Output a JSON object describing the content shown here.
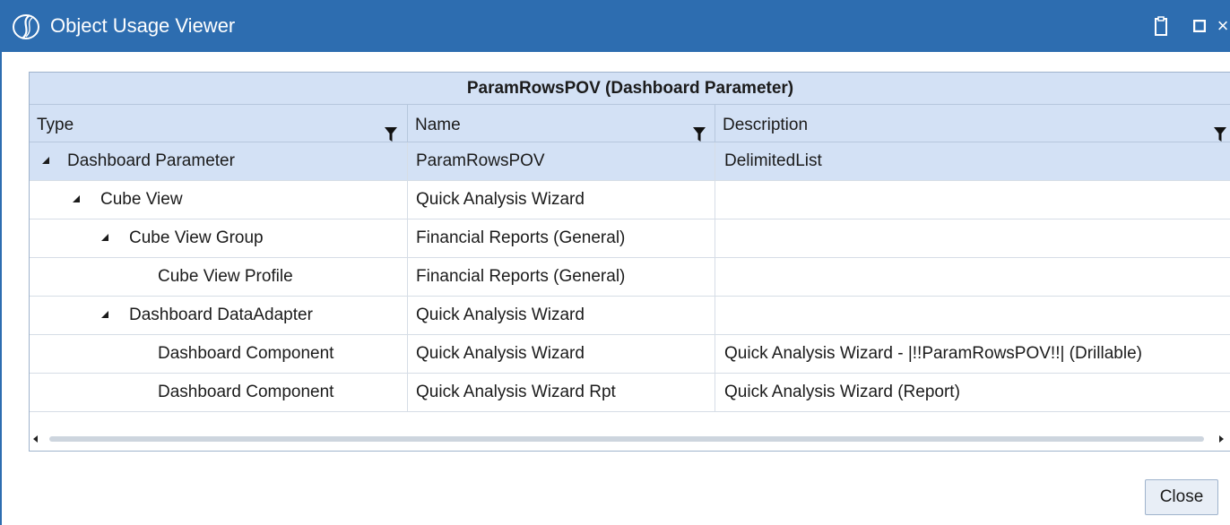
{
  "window": {
    "title": "Object Usage Viewer",
    "logo_icon": "onestream-swirl-icon",
    "titlebar_color": "#2d6db0",
    "controls": [
      "clipboard-icon",
      "maximize-icon",
      "close-icon"
    ],
    "close_glyph": "×"
  },
  "grid": {
    "group_header": "ParamRowsPOV  (Dashboard Parameter)",
    "header_color": "#d3e1f5",
    "columns": [
      {
        "label": "Type",
        "filter_icon": "filter-icon"
      },
      {
        "label": "Name",
        "filter_icon": "filter-icon"
      },
      {
        "label": "Description",
        "filter_icon": "filter-icon"
      }
    ],
    "rows": [
      {
        "type": "Dashboard Parameter",
        "name": "ParamRowsPOV",
        "description": "DelimitedList",
        "level": 0,
        "expanded": true,
        "selected": true
      },
      {
        "type": "Cube View",
        "name": "Quick Analysis Wizard",
        "description": "",
        "level": 1,
        "expanded": true,
        "selected": false
      },
      {
        "type": "Cube View Group",
        "name": "Financial Reports (General)",
        "description": "",
        "level": 2,
        "expanded": true,
        "selected": false
      },
      {
        "type": "Cube View Profile",
        "name": "Financial Reports (General)",
        "description": "",
        "level": 3,
        "expanded": null,
        "selected": false
      },
      {
        "type": "Dashboard DataAdapter",
        "name": "Quick Analysis Wizard",
        "description": "",
        "level": 2,
        "expanded": true,
        "selected": false
      },
      {
        "type": "Dashboard Component",
        "name": "Quick Analysis Wizard",
        "description": "Quick Analysis Wizard - |!!ParamRowsPOV!!| (Drillable)",
        "level": 3,
        "expanded": null,
        "selected": false
      },
      {
        "type": "Dashboard Component",
        "name": "Quick Analysis Wizard Rpt",
        "description": "Quick Analysis Wizard (Report)",
        "level": 3,
        "expanded": null,
        "selected": false
      }
    ]
  },
  "footer": {
    "close_label": "Close"
  }
}
